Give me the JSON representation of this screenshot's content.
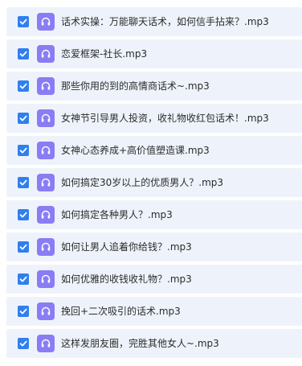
{
  "files": [
    {
      "name": "话术实操：万能聊天话术，如何信手拈来？.mp3",
      "checked": true,
      "icon": "audio-file-icon"
    },
    {
      "name": "恋爱框架-社长.mp3",
      "checked": true,
      "icon": "audio-file-icon"
    },
    {
      "name": "那些你用的到的高情商话术~.mp3",
      "checked": true,
      "icon": "audio-file-icon"
    },
    {
      "name": "女神节引导男人投资，收礼物收红包话术！.mp3",
      "checked": true,
      "icon": "audio-file-icon"
    },
    {
      "name": "女神心态养成+高价值塑造课.mp3",
      "checked": true,
      "icon": "audio-file-icon"
    },
    {
      "name": "如何搞定30岁以上的优质男人？.mp3",
      "checked": true,
      "icon": "audio-file-icon"
    },
    {
      "name": "如何搞定各种男人？.mp3",
      "checked": true,
      "icon": "audio-file-icon"
    },
    {
      "name": "如何让男人追着你给钱？.mp3",
      "checked": true,
      "icon": "audio-file-icon"
    },
    {
      "name": "如何优雅的收钱收礼物？.mp3",
      "checked": true,
      "icon": "audio-file-icon"
    },
    {
      "name": "挽回+二次吸引的话术.mp3",
      "checked": true,
      "icon": "audio-file-icon"
    },
    {
      "name": "这样发朋友圈，完胜其他女人~.mp3",
      "checked": true,
      "icon": "audio-file-icon"
    }
  ],
  "colors": {
    "row_background": "#eef3fb",
    "checkbox": "#2f7ff0",
    "file_icon": "#8a7cf4",
    "text": "#2b2b2b"
  }
}
